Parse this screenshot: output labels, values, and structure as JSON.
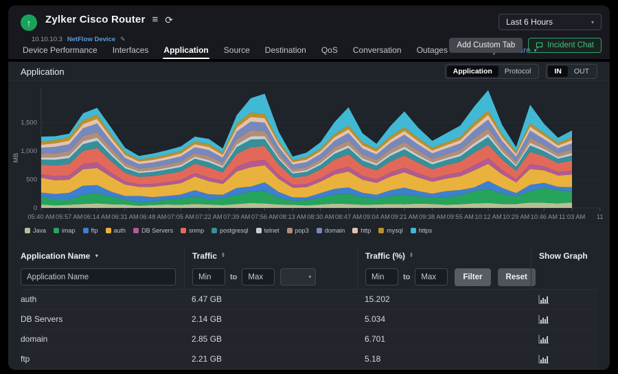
{
  "icons": {
    "status_up": "↑",
    "menu": "≡",
    "refresh": "⟳",
    "edit": "✎",
    "caret_down": "▾",
    "sort_desc": "▼",
    "sort_up": "▲"
  },
  "header": {
    "title": "Zylker Cisco Router",
    "ip": "10.10.10.3",
    "device_badge": "NetFlow Device",
    "time_range": "Last 6 Hours",
    "tabs": [
      "Device Performance",
      "Interfaces",
      "Application",
      "Source",
      "Destination",
      "QoS",
      "Conversation",
      "Outages",
      "Inventory"
    ],
    "active_tab": "Application",
    "more_label": "More",
    "add_custom_tab": "Add Custom Tab",
    "incident_chat": "Incident Chat"
  },
  "section": {
    "title": "Application",
    "view_options": [
      "Application",
      "Protocol"
    ],
    "view_active": "Application",
    "direction_options": [
      "IN",
      "OUT"
    ],
    "direction_active": "IN"
  },
  "chart_data": {
    "type": "area",
    "stacked": true,
    "unit": "MB",
    "ylabel": "MB",
    "yticks": [
      "0",
      "500",
      "1,000",
      "1,500"
    ],
    "ytick_values": [
      0,
      500,
      1000,
      1500
    ],
    "ylim": [
      0,
      2100
    ],
    "grid": true,
    "legend_position": "bottom",
    "x_labels": [
      "05:40 AM",
      "05:57 AM",
      "06:14 AM",
      "06:31 AM",
      "06:48 AM",
      "07:05 AM",
      "07:22 AM",
      "07:39 AM",
      "07:56 AM",
      "08:13 AM",
      "08:30 AM",
      "08:47 AM",
      "09:04 AM",
      "09:21 AM",
      "09:38 AM",
      "09:55 AM",
      "10:12 AM",
      "10:29 AM",
      "10:46 AM",
      "11:03 AM",
      "11"
    ],
    "points_per_label": 2,
    "series": [
      {
        "name": "Java",
        "color": "#b7bf96",
        "values": [
          60,
          45,
          55,
          70,
          80,
          65,
          60,
          40,
          50,
          60,
          55,
          70,
          60,
          50,
          70,
          85,
          80,
          60,
          55,
          45,
          60,
          75,
          70,
          55,
          60,
          70,
          65,
          75,
          70,
          55,
          65,
          80,
          85,
          70,
          70,
          95,
          90,
          80,
          95
        ]
      },
      {
        "name": "imap",
        "color": "#27a45c",
        "values": [
          140,
          100,
          90,
          160,
          180,
          130,
          90,
          60,
          60,
          90,
          110,
          130,
          90,
          120,
          160,
          200,
          220,
          120,
          70,
          90,
          120,
          160,
          180,
          130,
          100,
          140,
          170,
          130,
          110,
          130,
          160,
          220,
          250,
          180,
          130,
          200,
          260,
          230,
          200
        ]
      },
      {
        "name": "ftp",
        "color": "#3d7fd0",
        "values": [
          70,
          100,
          120,
          160,
          140,
          90,
          60,
          110,
          80,
          60,
          70,
          110,
          90,
          60,
          120,
          90,
          150,
          100,
          60,
          50,
          80,
          100,
          110,
          80,
          70,
          100,
          120,
          90,
          70,
          110,
          90,
          60,
          140,
          100,
          60,
          110,
          90,
          60,
          70
        ]
      },
      {
        "name": "auth",
        "color": "#e9b23c",
        "values": [
          260,
          240,
          230,
          290,
          300,
          260,
          200,
          160,
          180,
          190,
          200,
          240,
          230,
          190,
          290,
          340,
          300,
          230,
          170,
          180,
          200,
          250,
          280,
          230,
          210,
          240,
          270,
          240,
          210,
          220,
          240,
          300,
          300,
          240,
          190,
          280,
          220,
          200,
          220
        ]
      },
      {
        "name": "DB Servers",
        "color": "#b25a92",
        "values": [
          60,
          70,
          75,
          90,
          100,
          75,
          55,
          45,
          50,
          52,
          55,
          62,
          65,
          55,
          85,
          100,
          95,
          70,
          50,
          55,
          60,
          75,
          85,
          70,
          60,
          75,
          85,
          72,
          60,
          65,
          70,
          90,
          100,
          75,
          55,
          85,
          70,
          60,
          70
        ]
      },
      {
        "name": "snmp",
        "color": "#e2695a",
        "values": [
          170,
          190,
          200,
          230,
          250,
          200,
          150,
          130,
          140,
          145,
          150,
          165,
          175,
          150,
          225,
          250,
          240,
          180,
          130,
          140,
          155,
          190,
          215,
          175,
          160,
          190,
          210,
          185,
          160,
          170,
          185,
          220,
          235,
          185,
          145,
          215,
          175,
          155,
          175
        ]
      },
      {
        "name": "postgresql",
        "color": "#35909a",
        "values": [
          90,
          100,
          105,
          120,
          130,
          105,
          80,
          68,
          72,
          76,
          80,
          88,
          92,
          78,
          118,
          135,
          125,
          95,
          68,
          74,
          82,
          100,
          113,
          92,
          84,
          100,
          110,
          96,
          84,
          90,
          97,
          118,
          133,
          98,
          76,
          113,
          92,
          80,
          92
        ]
      },
      {
        "name": "telnet",
        "color": "#c9ced3",
        "values": [
          38,
          42,
          45,
          52,
          56,
          45,
          34,
          29,
          31,
          32,
          34,
          37,
          39,
          33,
          50,
          58,
          53,
          40,
          29,
          31,
          35,
          42,
          48,
          39,
          36,
          42,
          47,
          41,
          36,
          38,
          41,
          50,
          57,
          42,
          32,
          48,
          39,
          34,
          39
        ]
      },
      {
        "name": "pop3",
        "color": "#b18e79",
        "values": [
          68,
          75,
          80,
          92,
          100,
          80,
          61,
          52,
          55,
          58,
          61,
          66,
          70,
          59,
          90,
          104,
          95,
          71,
          52,
          56,
          62,
          76,
          86,
          70,
          64,
          75,
          84,
          74,
          64,
          68,
          74,
          90,
          102,
          76,
          57,
          86,
          70,
          60,
          70
        ]
      },
      {
        "name": "domain",
        "color": "#7589bf",
        "values": [
          100,
          110,
          118,
          135,
          147,
          118,
          90,
          77,
          81,
          85,
          90,
          97,
          103,
          87,
          132,
          153,
          140,
          105,
          77,
          83,
          92,
          112,
          127,
          103,
          94,
          110,
          124,
          109,
          94,
          100,
          109,
          132,
          150,
          112,
          84,
          127,
          103,
          89,
          103
        ]
      },
      {
        "name": "http",
        "color": "#e6c3ad",
        "values": [
          56,
          62,
          66,
          75,
          82,
          66,
          50,
          43,
          45,
          47,
          50,
          54,
          57,
          48,
          73,
          85,
          78,
          58,
          43,
          46,
          51,
          62,
          70,
          57,
          52,
          61,
          69,
          60,
          52,
          56,
          61,
          73,
          83,
          62,
          47,
          70,
          57,
          49,
          57
        ]
      },
      {
        "name": "mysql",
        "color": "#bb9129",
        "values": [
          50,
          55,
          59,
          67,
          73,
          59,
          45,
          38,
          40,
          42,
          45,
          48,
          51,
          43,
          66,
          76,
          70,
          52,
          38,
          41,
          46,
          55,
          63,
          51,
          47,
          55,
          62,
          54,
          47,
          50,
          54,
          66,
          75,
          55,
          42,
          63,
          51,
          44,
          51
        ]
      },
      {
        "name": "https",
        "color": "#41b9d5",
        "values": [
          90,
          70,
          60,
          120,
          120,
          120,
          80,
          60,
          70,
          75,
          80,
          85,
          90,
          70,
          150,
          250,
          360,
          160,
          60,
          80,
          110,
          210,
          320,
          160,
          90,
          180,
          280,
          180,
          120,
          160,
          200,
          280,
          360,
          160,
          80,
          320,
          160,
          90,
          120
        ]
      }
    ]
  },
  "table": {
    "columns": [
      "Application Name",
      "Traffic",
      "Traffic (%)",
      "Show Graph"
    ],
    "filter": {
      "name_placeholder": "Application Name",
      "min_placeholder": "Min",
      "to_label": "to",
      "max_placeholder": "Max",
      "filter_label": "Filter",
      "reset_label": "Reset"
    },
    "rows": [
      {
        "name": "auth",
        "traffic": "6.47 GB",
        "pct": "15.202"
      },
      {
        "name": "DB Servers",
        "traffic": "2.14 GB",
        "pct": "5.034"
      },
      {
        "name": "domain",
        "traffic": "2.85 GB",
        "pct": "6.701"
      },
      {
        "name": "ftp",
        "traffic": "2.21 GB",
        "pct": "5.18"
      }
    ]
  }
}
